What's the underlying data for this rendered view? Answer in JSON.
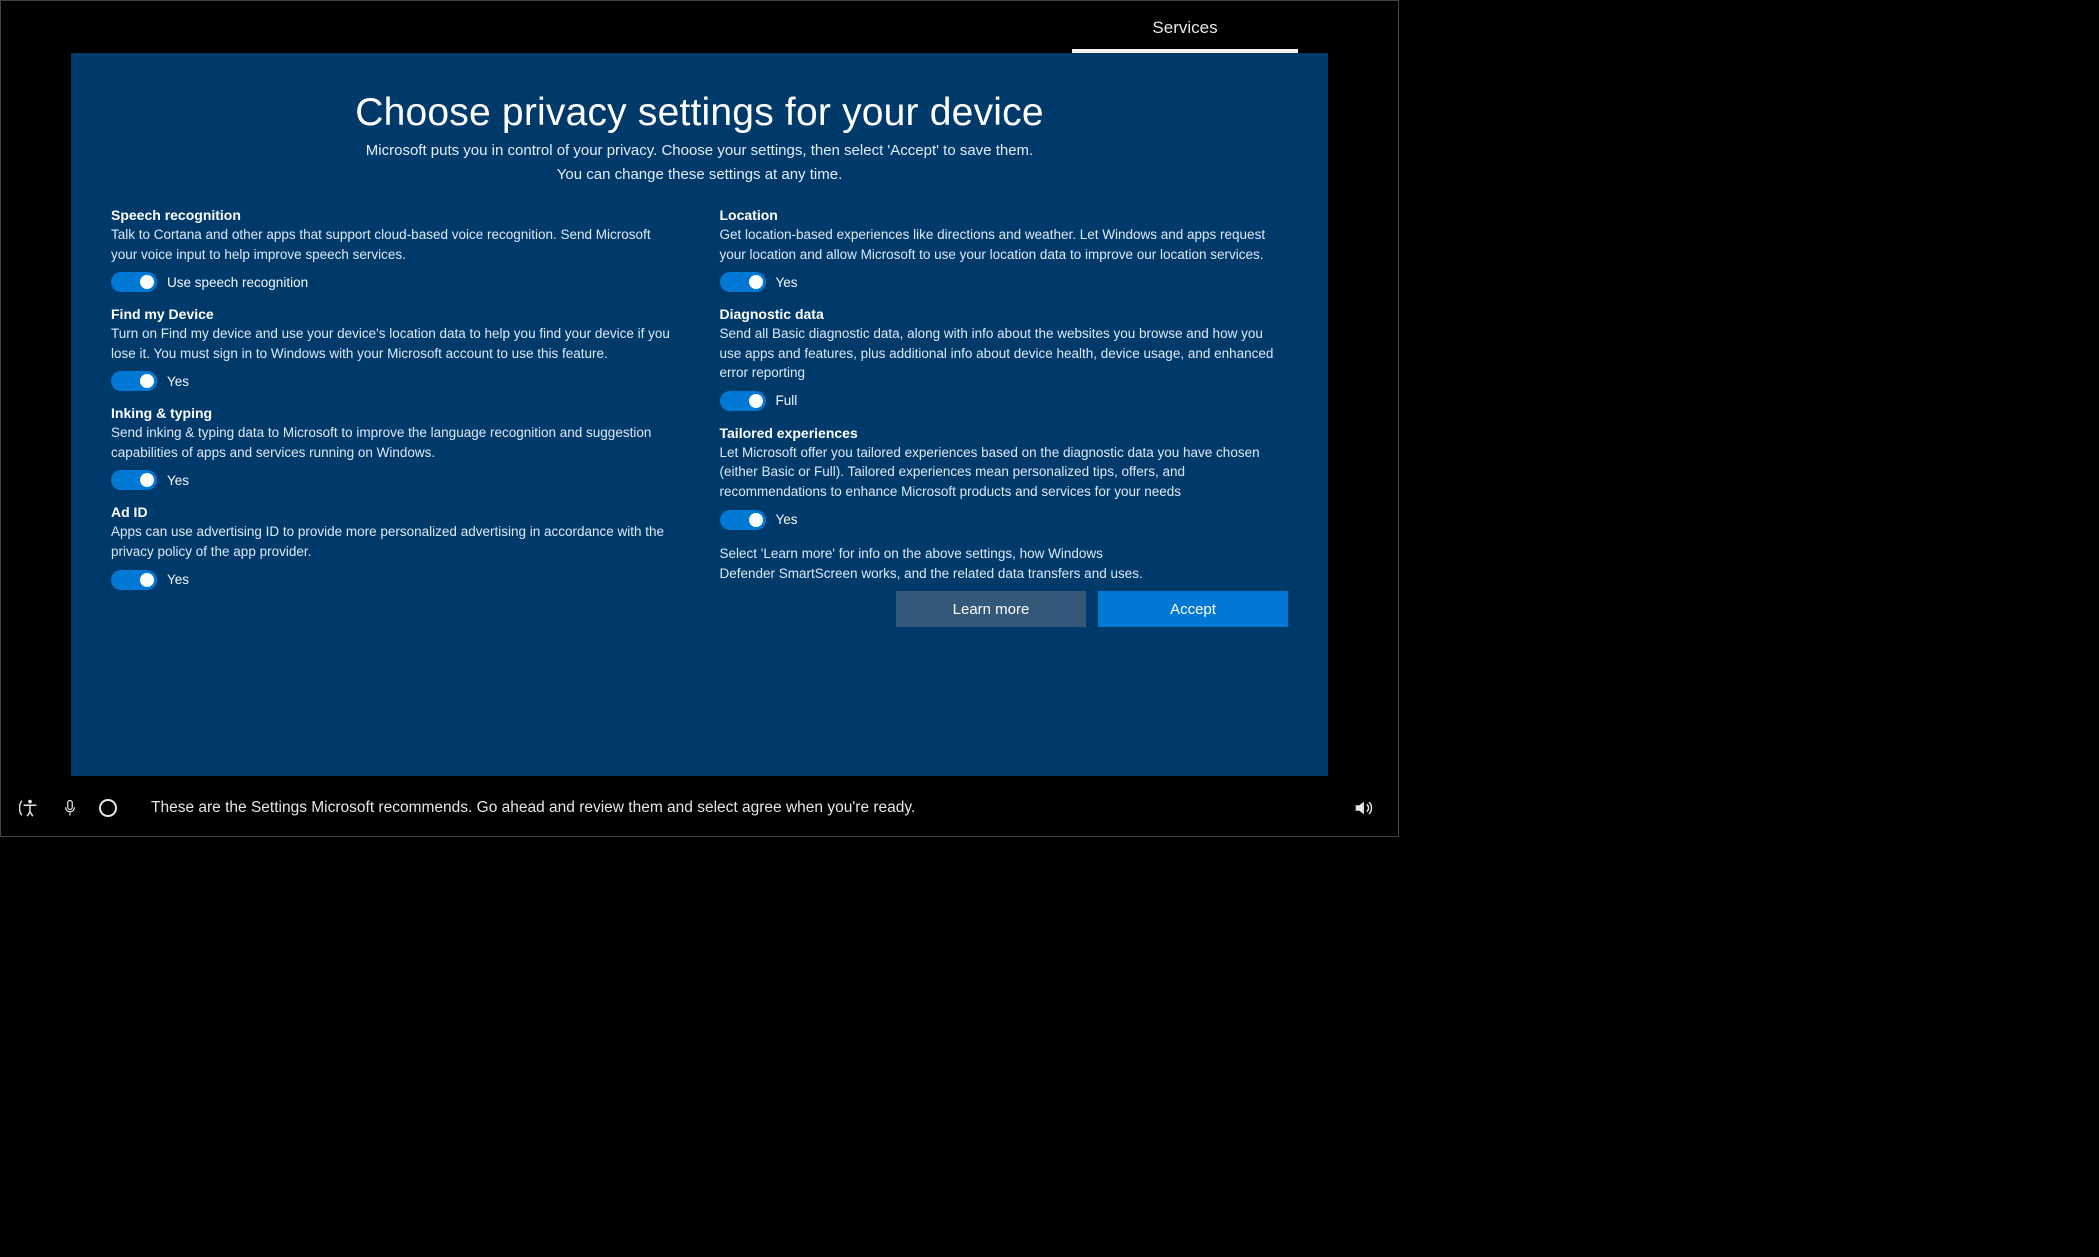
{
  "tab": {
    "label": "Services"
  },
  "header": {
    "title": "Choose privacy settings for your device",
    "subtitle_line1": "Microsoft puts you in control of your privacy. Choose your settings, then select 'Accept' to save them.",
    "subtitle_line2": "You can change these settings at any time."
  },
  "settings": {
    "speech": {
      "title": "Speech recognition",
      "desc": "Talk to Cortana and other apps that support cloud-based voice recognition.  Send Microsoft your voice input to help improve speech services.",
      "toggle_label": "Use speech recognition",
      "on": true
    },
    "find": {
      "title": "Find my Device",
      "desc": "Turn on Find my device and use your device's location data to help you find your device if you lose it. You must sign in to Windows with your Microsoft account to use this feature.",
      "toggle_label": "Yes",
      "on": true
    },
    "inking": {
      "title": "Inking & typing",
      "desc": "Send inking & typing data to Microsoft to improve the language recognition and suggestion capabilities of apps and services running on Windows.",
      "toggle_label": "Yes",
      "on": true
    },
    "adid": {
      "title": "Ad ID",
      "desc": "Apps can use advertising ID to provide more personalized advertising in accordance with the privacy policy of the app provider.",
      "toggle_label": "Yes",
      "on": true
    },
    "location": {
      "title": "Location",
      "desc": "Get location-based experiences like directions and weather.  Let Windows and apps request your location and allow Microsoft to use your location data to improve our location services.",
      "toggle_label": "Yes",
      "on": true
    },
    "diag": {
      "title": "Diagnostic data",
      "desc": "Send all Basic diagnostic data, along with info about the websites you browse and how you use apps and features, plus additional info about device health, device usage, and enhanced error reporting",
      "toggle_label": "Full",
      "on": true
    },
    "tailored": {
      "title": "Tailored experiences",
      "desc": "Let Microsoft offer you tailored experiences based on the diagnostic data you have chosen (either Basic or Full). Tailored experiences mean personalized tips, offers, and recommendations to enhance Microsoft products and services for your needs",
      "toggle_label": "Yes",
      "on": true
    },
    "footnote": {
      "line1": "Select 'Learn more' for info on the above settings, how Windows",
      "line2": "Defender SmartScreen works, and the related data transfers and uses."
    }
  },
  "buttons": {
    "learn_more": "Learn more",
    "accept": "Accept"
  },
  "bottom": {
    "narration": "These are the Settings Microsoft recommends. Go ahead and review them and select agree when you're ready."
  }
}
